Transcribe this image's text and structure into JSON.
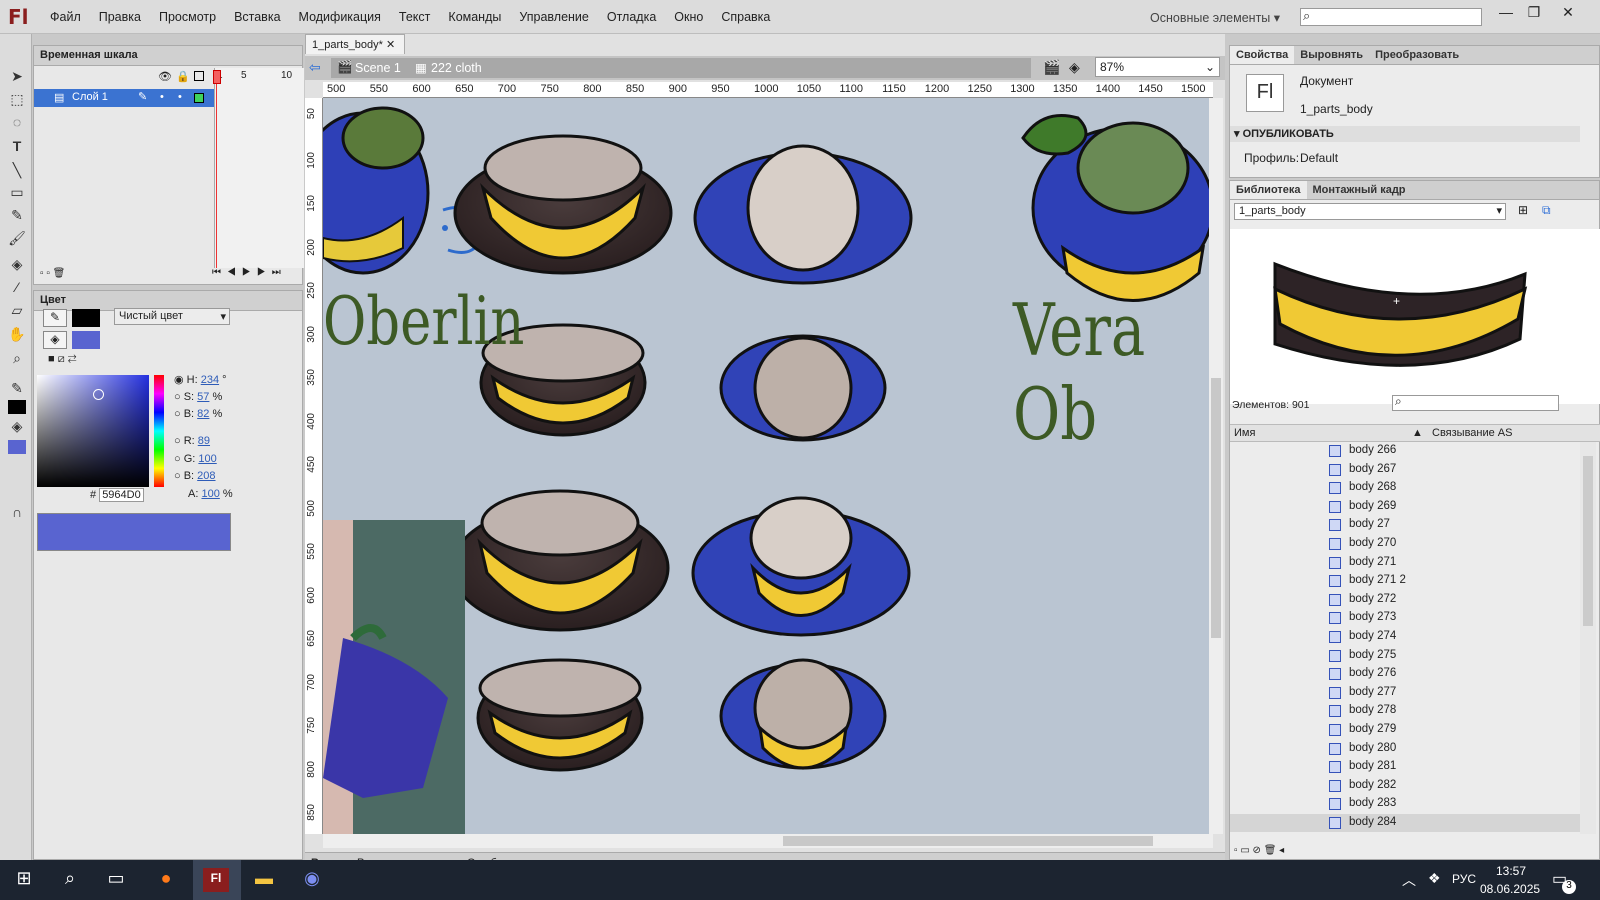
{
  "app": {
    "logo": "Fl",
    "menu": [
      "Файл",
      "Правка",
      "Просмотр",
      "Вставка",
      "Модификация",
      "Текст",
      "Команды",
      "Управление",
      "Отладка",
      "Окно",
      "Справка"
    ],
    "workspace": "Основные элементы",
    "window_buttons": [
      "—",
      "❐",
      "✕"
    ]
  },
  "timeline": {
    "title": "Временная шкала",
    "layer_name": "Слой 1",
    "frame_numbers": [
      "1",
      "5",
      "10"
    ]
  },
  "color_panel": {
    "title": "Цвет",
    "fill_type": "Чистый цвет",
    "H": "234",
    "S": "57",
    "B": "82",
    "R": "89",
    "G": "100",
    "Bv": "208",
    "hex": "5964D0",
    "alpha": "100",
    "H_label": "H:",
    "S_label": "S:",
    "B_label": "B:",
    "R_label": "R:",
    "G_label": "G:",
    "Bv_label": "B:",
    "A_label": "A:",
    "deg": "°",
    "pct": "%",
    "hash": "#",
    "current_color": "#5964d0"
  },
  "document": {
    "tab": "1_parts_body*",
    "scene": "Scene 1",
    "symbol": "222 cloth",
    "zoom": "87%",
    "hruler": [
      "500",
      "550",
      "600",
      "650",
      "700",
      "750",
      "800",
      "850",
      "900",
      "950",
      "1000",
      "1050",
      "1100",
      "1150",
      "1200",
      "1250",
      "1300",
      "1350",
      "1400",
      "1450",
      "1500"
    ],
    "vruler": [
      "50",
      "100",
      "150",
      "200",
      "250",
      "300",
      "350",
      "400",
      "450",
      "500",
      "550",
      "600",
      "650",
      "700",
      "750",
      "800",
      "850"
    ],
    "stage_text_1": "Oberlin",
    "stage_text_2": "Vera Ob",
    "bottom_tabs": [
      "Вывод",
      "Редактор движения",
      "Ошибки компиляции"
    ]
  },
  "properties": {
    "tabs": [
      "Свойства",
      "Выровнять",
      "Преобразовать"
    ],
    "doc_label": "Документ",
    "doc_icon": "Fl",
    "doc_name": "1_parts_body",
    "section": "ОПУБЛИКОВАТЬ",
    "profile_label": "Профиль:",
    "profile_value": "Default"
  },
  "library": {
    "tabs": [
      "Библиотека",
      "Монтажный кадр"
    ],
    "doc_select": "1_parts_body",
    "elements_count": "Элементов: 901",
    "col_name": "Имя",
    "col_linkage": "Связывание AS",
    "items": [
      "body 266",
      "body 267",
      "body 268",
      "body 269",
      "body 27",
      "body 270",
      "body 271",
      "body 271 2",
      "body 272",
      "body 273",
      "body 274",
      "body 275",
      "body 276",
      "body 277",
      "body 278",
      "body 279",
      "body 280",
      "body 281",
      "body 282",
      "body 283",
      "body 284"
    ]
  },
  "taskbar": {
    "lang": "РУС",
    "time": "13:57",
    "date": "08.06.2025",
    "notif_count": "3",
    "fl_label": "Fl"
  }
}
